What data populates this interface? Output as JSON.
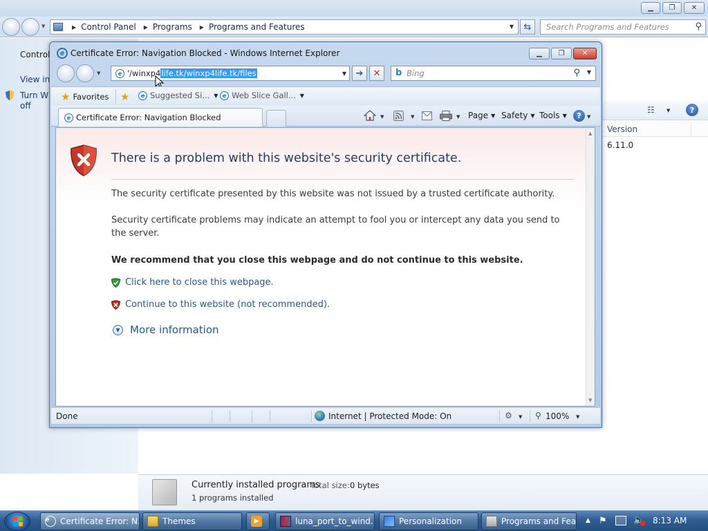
{
  "control_panel": {
    "breadcrumb": [
      "Control Panel",
      "Programs",
      "Programs and Features"
    ],
    "search_placeholder": "Search Programs and Features",
    "left_pane": {
      "item1": "Control",
      "item2": "View ins",
      "item3a": "Turn Wi",
      "item3b": "off"
    },
    "column_version": "Version",
    "version_value": "6.11.0",
    "bottom": {
      "title": "Currently installed programs",
      "total_size_label": "Total size:",
      "total_size_value": "0 bytes",
      "count": "1 programs installed"
    }
  },
  "ie": {
    "window_title": "Certificate Error: Navigation Blocked - Windows Internet Explorer",
    "address_prefix": "'/winxp4",
    "address_selected": "life.tk/winxp4life.tk/files",
    "search_placeholder": "Bing",
    "favorites": {
      "favorites_label": "Favorites",
      "suggested": "Suggested Si...",
      "webslice": "Web Slice Gall..."
    },
    "tab_title": "Certificate Error: Navigation Blocked",
    "command_bar": {
      "page": "Page",
      "safety": "Safety",
      "tools": "Tools"
    },
    "content": {
      "heading": "There is a problem with this website's security certificate.",
      "para1": "The security certificate presented by this website was not issued by a trusted certificate authority.",
      "para2": "Security certificate problems may indicate an attempt to fool you or intercept any data you send to the server.",
      "recommend": "We recommend that you close this webpage and do not continue to this website.",
      "close_link": "Click here to close this webpage.",
      "continue_link": "Continue to this website (not recommended).",
      "more_info": "More information"
    },
    "status": {
      "left": "Done",
      "zone": "Internet | Protected Mode: On",
      "zoom": "100%"
    }
  },
  "taskbar": {
    "buttons": [
      {
        "label": "Certificate Error: N...",
        "icon": "ie-icon"
      },
      {
        "label": "Themes",
        "icon": "folder-icon"
      },
      {
        "label": "",
        "icon": "media-player-icon"
      },
      {
        "label": "luna_port_to_wind...",
        "icon": "winrar-icon"
      },
      {
        "label": "Personalization",
        "icon": "personalization-icon"
      },
      {
        "label": "Programs and Fea...",
        "icon": "control-panel-icon"
      }
    ],
    "clock": "8:13 AM"
  },
  "colors": {
    "link": "#1e5b8c",
    "heading": "#233d66",
    "taskbar": "#2f5d93",
    "error_red": "#c5301d",
    "ok_green": "#2f9a3a"
  }
}
